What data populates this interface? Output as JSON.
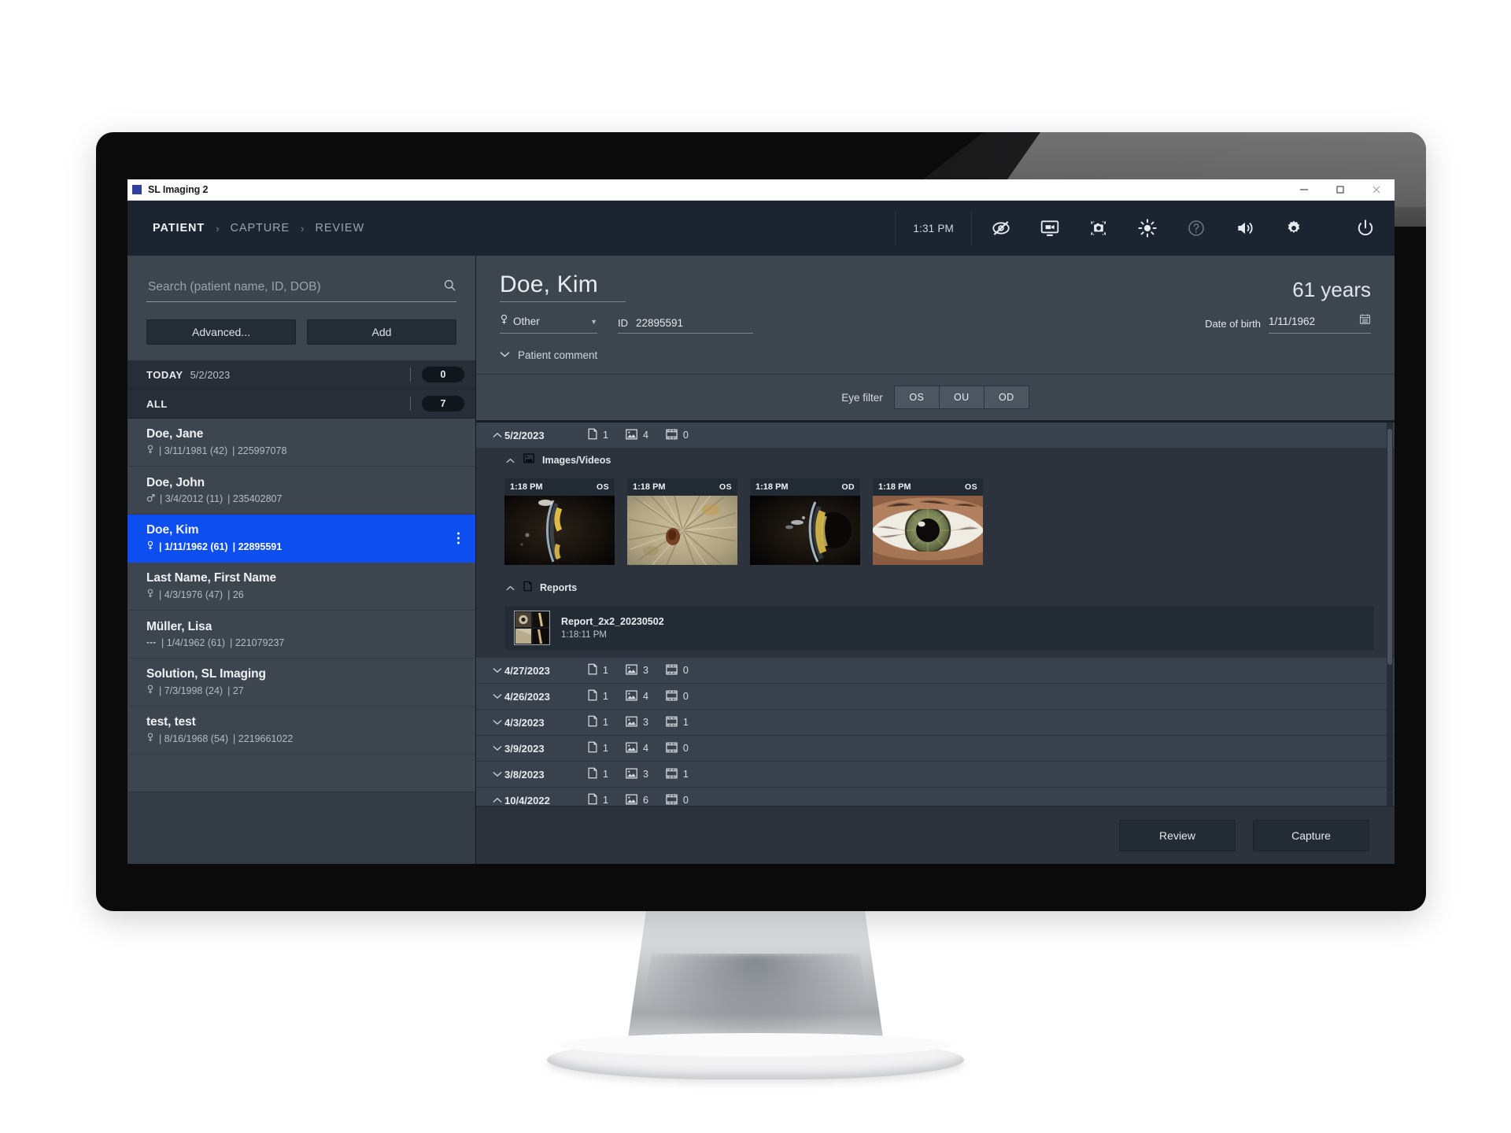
{
  "window": {
    "title": "SL Imaging 2",
    "controls": {
      "minimize": "minimize-icon",
      "maximize": "maximize-icon",
      "close": "close-icon"
    }
  },
  "appbar": {
    "breadcrumbs": [
      {
        "label": "PATIENT",
        "active": true
      },
      {
        "label": "CAPTURE",
        "active": false
      },
      {
        "label": "REVIEW",
        "active": false
      }
    ],
    "separator": "›",
    "clock": "1:31 PM",
    "icons": [
      {
        "name": "eye-slash-icon",
        "label": "Hide overlay"
      },
      {
        "name": "monitor-video-icon",
        "label": "Display"
      },
      {
        "name": "camera-capture-icon",
        "label": "Capture"
      },
      {
        "name": "brightness-icon",
        "label": "Brightness"
      },
      {
        "name": "help-icon",
        "label": "Help"
      },
      {
        "name": "volume-icon",
        "label": "Volume"
      },
      {
        "name": "settings-gear-icon",
        "label": "Settings"
      },
      {
        "name": "power-icon",
        "label": "Power"
      }
    ]
  },
  "sidebar": {
    "search": {
      "placeholder": "Search (patient name, ID, DOB)",
      "value": ""
    },
    "advanced_label": "Advanced...",
    "add_label": "Add",
    "groups": [
      {
        "label": "TODAY",
        "date": "5/2/2023",
        "count": "0"
      },
      {
        "label": "ALL",
        "date": "",
        "count": "7"
      }
    ],
    "patients": [
      {
        "name": "Doe, Jane",
        "gender": "female",
        "dob": "3/11/1981",
        "age": "42",
        "id": "225997078",
        "selected": false
      },
      {
        "name": "Doe, John",
        "gender": "male",
        "dob": "3/4/2012",
        "age": "11",
        "id": "235402807",
        "selected": false
      },
      {
        "name": "Doe, Kim",
        "gender": "female",
        "dob": "1/11/1962",
        "age": "61",
        "id": "22895591",
        "selected": true
      },
      {
        "name": "Last Name, First Name",
        "gender": "female",
        "dob": "4/3/1976",
        "age": "47",
        "id": "26",
        "selected": false
      },
      {
        "name": "Müller, Lisa",
        "gender": "other",
        "dob": "1/4/1962",
        "age": "61",
        "id": "221079237",
        "selected": false
      },
      {
        "name": "Solution, SL Imaging",
        "gender": "female",
        "dob": "7/3/1998",
        "age": "24",
        "id": "27",
        "selected": false
      },
      {
        "name": "test, test",
        "gender": "female",
        "dob": "8/16/1968",
        "age": "54",
        "id": "2219661022",
        "selected": false
      }
    ]
  },
  "patient": {
    "name": "Doe, Kim",
    "age_text": "61 years",
    "gender_value": "Other",
    "id_label": "ID",
    "id_value": "22895591",
    "dob_label": "Date of birth",
    "dob_value": "1/11/1962",
    "comment_label": "Patient comment"
  },
  "eye_filter": {
    "label": "Eye filter",
    "options": [
      "OS",
      "OU",
      "OD"
    ]
  },
  "studies": {
    "expanded": {
      "date": "5/2/2023",
      "reports_count": "1",
      "images_count": "4",
      "videos_count": "0",
      "images_section_label": "Images/Videos",
      "reports_section_label": "Reports",
      "thumbnails": [
        {
          "time": "1:18 PM",
          "eye": "OS",
          "kind": "slitlamp-beam-left"
        },
        {
          "time": "1:18 PM",
          "eye": "OS",
          "kind": "iris-texture-lesion"
        },
        {
          "time": "1:18 PM",
          "eye": "OD",
          "kind": "slitlamp-crescent"
        },
        {
          "time": "1:18 PM",
          "eye": "OS",
          "kind": "full-eye-hazel"
        }
      ],
      "reports": [
        {
          "name": "Report_2x2_20230502",
          "time": "1:18:11 PM"
        }
      ]
    },
    "collapsed": [
      {
        "date": "4/27/2023",
        "reports_count": "1",
        "images_count": "3",
        "videos_count": "0",
        "chevron": "down"
      },
      {
        "date": "4/26/2023",
        "reports_count": "1",
        "images_count": "4",
        "videos_count": "0",
        "chevron": "down"
      },
      {
        "date": "4/3/2023",
        "reports_count": "1",
        "images_count": "3",
        "videos_count": "1",
        "chevron": "down"
      },
      {
        "date": "3/9/2023",
        "reports_count": "1",
        "images_count": "4",
        "videos_count": "0",
        "chevron": "down"
      },
      {
        "date": "3/8/2023",
        "reports_count": "1",
        "images_count": "3",
        "videos_count": "1",
        "chevron": "down"
      },
      {
        "date": "10/4/2022",
        "reports_count": "1",
        "images_count": "6",
        "videos_count": "0",
        "chevron": "up"
      }
    ]
  },
  "footer": {
    "review_label": "Review",
    "capture_label": "Capture"
  },
  "colors": {
    "selection_blue": "#0c4ef0",
    "appbar": "#1b2430",
    "sidebar": "#3d464f",
    "content": "#2c333c"
  }
}
